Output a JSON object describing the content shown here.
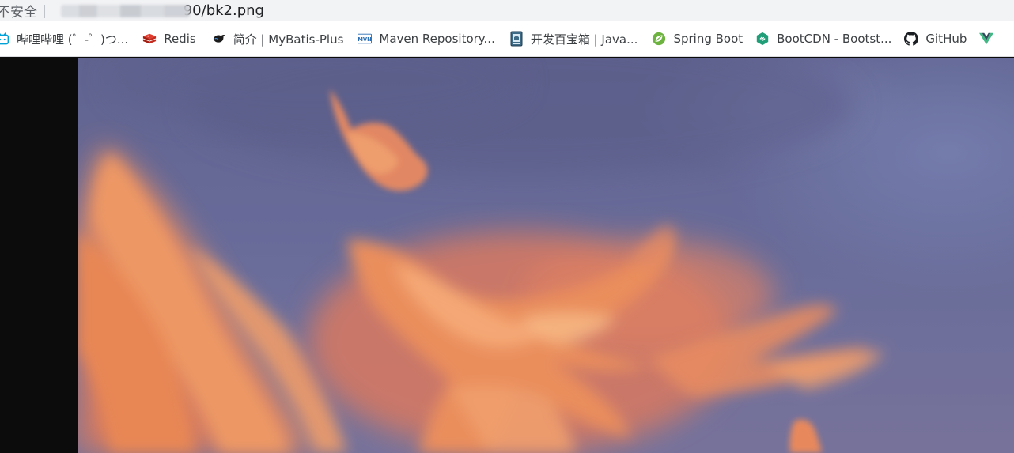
{
  "address_bar": {
    "security_label": "不安全",
    "separator": "|",
    "url_visible_suffix": "90/bk2.png"
  },
  "bookmarks": [
    {
      "label": "哔哩哔哩 (゜-゜)つ...",
      "icon": "bilibili-icon"
    },
    {
      "label": "Redis",
      "icon": "redis-icon"
    },
    {
      "label": "简介 | MyBatis-Plus",
      "icon": "mybatis-bird-icon"
    },
    {
      "label": "Maven Repository...",
      "icon": "mvn-icon"
    },
    {
      "label": "开发百宝箱 | Java...",
      "icon": "toolbox-icon"
    },
    {
      "label": "Spring Boot",
      "icon": "spring-leaf-icon"
    },
    {
      "label": "BootCDN - Bootst...",
      "icon": "bootcdn-icon"
    },
    {
      "label": "GitHub",
      "icon": "github-icon"
    }
  ],
  "colors": {
    "sky": "#676a97",
    "cloud_orange": "#f08a55",
    "page_bg": "#0c0c0c",
    "bilibili": "#00a1d6",
    "redis": "#d82c20",
    "mvn": "#2a6fb5",
    "spring": "#6db33f",
    "bootcdn": "#1f9e77",
    "vue": "#41b883"
  }
}
